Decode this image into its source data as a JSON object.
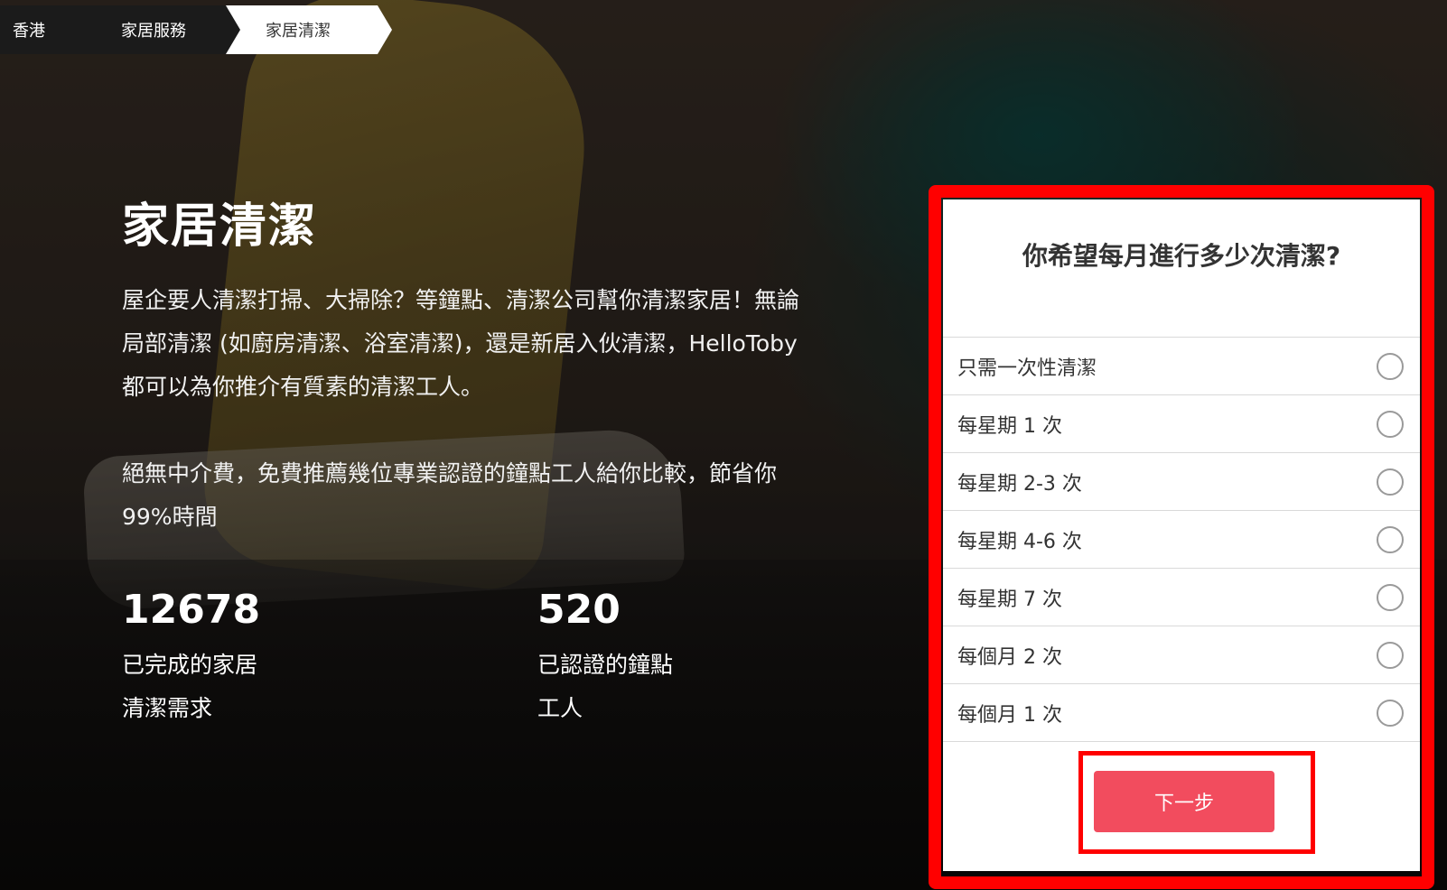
{
  "breadcrumb": {
    "items": [
      {
        "label": "香港"
      },
      {
        "label": "家居服務"
      },
      {
        "label": "家居清潔"
      }
    ]
  },
  "hero": {
    "title": "家居清潔",
    "description": "屋企要人清潔打掃、大掃除？等鐘點、清潔公司幫你清潔家居！無論局部清潔 (如廚房清潔、浴室清潔)，還是新居入伙清潔，HelloToby 都可以為你推介有質素的清潔工人。",
    "description2": "絕無中介費，免費推薦幾位專業認證的鐘點工人給你比較，節省你99%時間"
  },
  "stats": [
    {
      "number": "12678",
      "label": "已完成的家居清潔需求"
    },
    {
      "number": "520",
      "label": "已認證的鐘點工人"
    }
  ],
  "form": {
    "question": "你希望每月進行多少次清潔?",
    "options": [
      {
        "label": "只需一次性清潔",
        "selected": false
      },
      {
        "label": "每星期 1 次",
        "selected": false
      },
      {
        "label": "每星期 2-3 次",
        "selected": false
      },
      {
        "label": "每星期 4-6 次",
        "selected": false
      },
      {
        "label": "每星期 7 次",
        "selected": false
      },
      {
        "label": "每個月 2 次",
        "selected": false
      },
      {
        "label": "每個月 1 次",
        "selected": false
      }
    ],
    "next_label": "下一步"
  },
  "colors": {
    "accent": "#f24c5e",
    "highlight": "#ff0000"
  }
}
